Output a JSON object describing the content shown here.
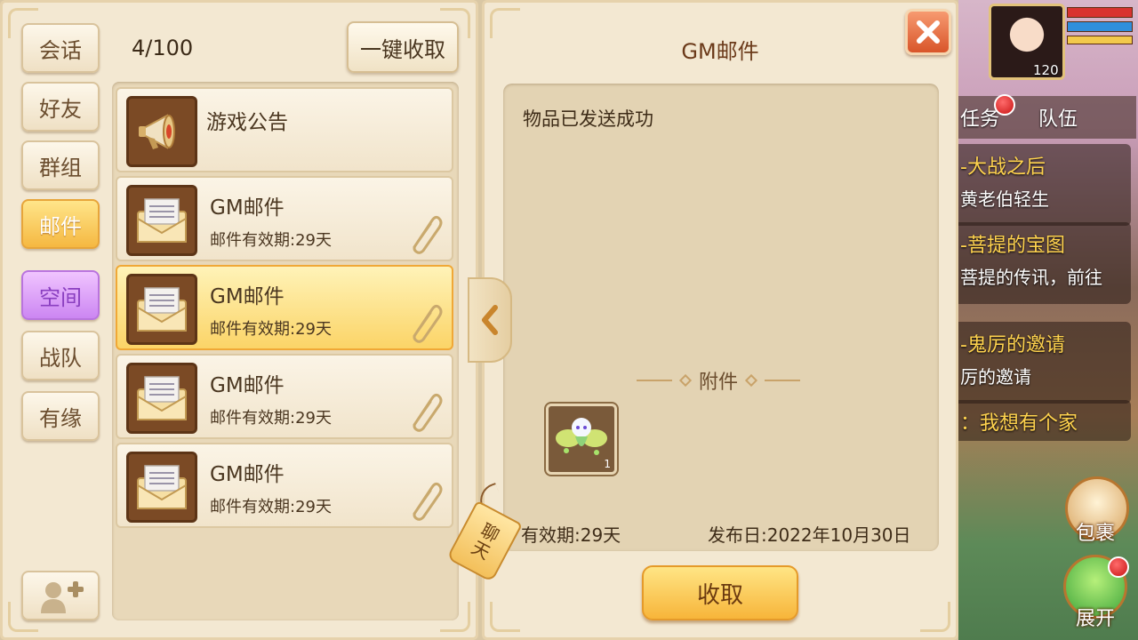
{
  "sidebar": {
    "tabs": [
      {
        "label": "会话"
      },
      {
        "label": "好友"
      },
      {
        "label": "群组"
      },
      {
        "label": "邮件"
      },
      {
        "label": "空间"
      },
      {
        "label": "战队"
      },
      {
        "label": "有缘"
      }
    ],
    "active_tab": "邮件"
  },
  "mail_list": {
    "counter": "4/100",
    "collect_all_label": "一键收取",
    "items": [
      {
        "title": "游戏公告",
        "subtitle": "",
        "type": "announcement"
      },
      {
        "title": "GM邮件",
        "subtitle": "邮件有效期:29天",
        "type": "mail",
        "has_attachment": true
      },
      {
        "title": "GM邮件",
        "subtitle": "邮件有效期:29天",
        "type": "mail",
        "has_attachment": true,
        "selected": true
      },
      {
        "title": "GM邮件",
        "subtitle": "邮件有效期:29天",
        "type": "mail",
        "has_attachment": true
      },
      {
        "title": "GM邮件",
        "subtitle": "邮件有效期:29天",
        "type": "mail",
        "has_attachment": true
      }
    ]
  },
  "chat_tag": {
    "label": "聊天"
  },
  "mail_detail": {
    "title": "GM邮件",
    "body": "物品已发送成功",
    "attachment_label": "附件",
    "attachment_count": "1",
    "validity": "有效期:29天",
    "publish_date": "发布日:2022年10月30日",
    "collect_label": "收取"
  },
  "hud": {
    "level": "120",
    "quest_tabs": [
      "任务",
      "队伍"
    ],
    "quests": [
      {
        "title": "-大战之后",
        "desc": "黄老伯轻生"
      },
      {
        "title": "-菩提的宝图",
        "desc": "菩提的传讯，前往"
      },
      {
        "title": "-鬼厉的邀请",
        "desc": "厉的邀请"
      },
      {
        "title": "：我想有个家",
        "desc": ""
      }
    ],
    "bag_label": "包裹",
    "expand_label": "展开"
  },
  "colors": {
    "panel_bg": "#f3e8d2",
    "active_tab": "#f5b841",
    "space_tab": "#cc86f2",
    "close_red": "#d8552a",
    "quest_title": "#ffd34e"
  },
  "icons": [
    "megaphone-icon",
    "envelope-icon",
    "paperclip-icon",
    "close-icon",
    "chevron-left-icon",
    "add-friend-icon"
  ]
}
